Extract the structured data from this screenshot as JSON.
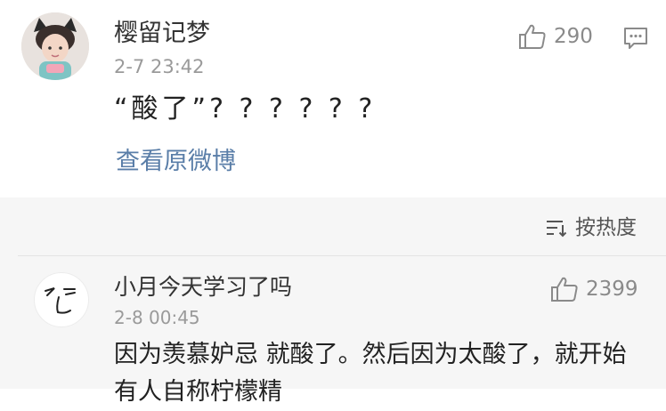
{
  "post": {
    "username": "樱留记梦",
    "time": "2-7 23:42",
    "likes": "290",
    "content": "“酸了”? ? ? ? ? ?",
    "view_original": "查看原微博"
  },
  "comments_header": {
    "sort_label": "按热度"
  },
  "comment": {
    "username": "小月今天学习了吗",
    "time": "2-8 00:45",
    "likes": "2399",
    "content": "因为羡慕妒忌 就酸了。然后因为太酸了，就开始有人自称柠檬精"
  },
  "colors": {
    "link": "#5a7ea8",
    "gray_bg": "#f6f6f6",
    "muted_text": "#9a9a9a"
  },
  "icons": {
    "like": "thumbs-up-icon",
    "comment": "comment-icon",
    "sort": "sort-icon"
  }
}
